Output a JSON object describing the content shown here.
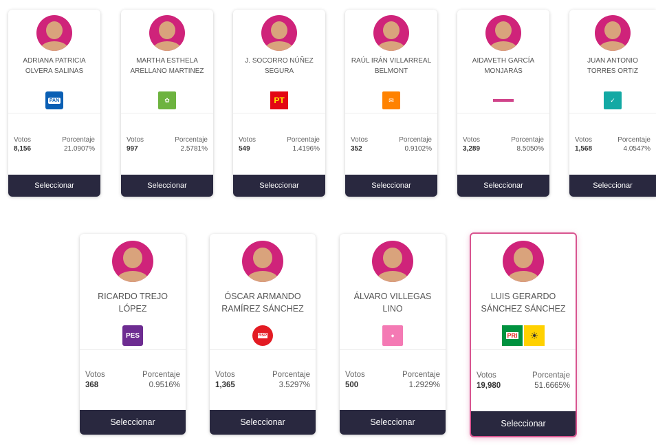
{
  "labels": {
    "votes": "Votos",
    "percentage": "Porcentaje",
    "select_button": "Seleccionar"
  },
  "candidates": [
    {
      "name": "ADRIANA PATRICIA OLVERA SALINAS",
      "party_icon": "pan-logo-icon",
      "votes": "8,156",
      "percentage": "21.0907%"
    },
    {
      "name": "MARTHA ESTHELA ARELLANO MARTINEZ",
      "party_icon": "pvem-logo-icon",
      "votes": "997",
      "percentage": "2.5781%"
    },
    {
      "name": "J. SOCORRO NÚÑEZ SEGURA",
      "party_icon": "pt-logo-icon",
      "votes": "549",
      "percentage": "1.4196%"
    },
    {
      "name": "RAÚL IRÁN VILLARREAL BELMONT",
      "party_icon": "movimiento-ciudadano-logo-icon",
      "votes": "352",
      "percentage": "0.9102%"
    },
    {
      "name": "AIDAVETH GARCÍA MONJARÁS",
      "party_icon": "morena-logo-icon",
      "votes": "3,289",
      "percentage": "8.5050%"
    },
    {
      "name": "JUAN ANTONIO TORRES ORTIZ",
      "party_icon": "nueva-alianza-logo-icon",
      "votes": "1,568",
      "percentage": "4.0547%"
    },
    {
      "name": "RICARDO TREJO LÓPEZ",
      "party_icon": "pes-logo-icon",
      "votes": "368",
      "percentage": "0.9516%"
    },
    {
      "name": "ÓSCAR ARMANDO RAMÍREZ SÁNCHEZ",
      "party_icon": "rsp-logo-icon",
      "votes": "1,365",
      "percentage": "3.5297%"
    },
    {
      "name": "ÁLVARO VILLEGAS LINO",
      "party_icon": "fuerza-por-mexico-logo-icon",
      "votes": "500",
      "percentage": "1.2929%"
    },
    {
      "name": "LUIS GERARDO SÁNCHEZ SÁNCHEZ",
      "party_icon": "pri-prd-coalition-logo-icon",
      "votes": "19,980",
      "percentage": "51.6665%",
      "selected": true
    }
  ],
  "logo_text": {
    "pan": "PAN",
    "pt": "PT",
    "pes": "PES",
    "rsp": "RSP",
    "pri": "PRI",
    "prd": "PRD"
  },
  "colors": {
    "avatar_bg": "#cf237a",
    "button_bg": "#29283f",
    "selected_border": "#d8548f"
  }
}
